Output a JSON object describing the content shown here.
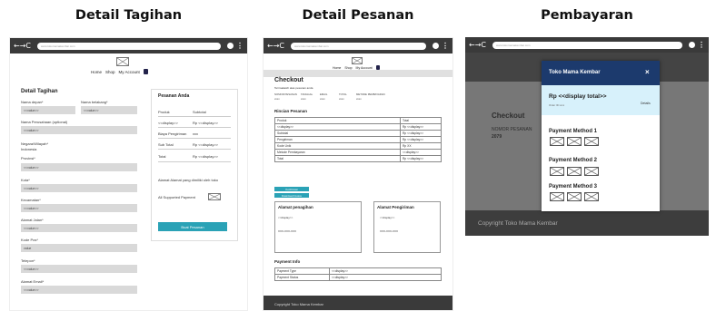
{
  "panels": {
    "tagihan": {
      "title": "Detail Tagihan"
    },
    "pesanan": {
      "title": "Detail Pesanan"
    },
    "pembayaran": {
      "title": "Pembayaran"
    }
  },
  "browser": {
    "nav": "←→C",
    "url1": "www.tokomamakembar.com",
    "url2": "www.tokomamakembar.com",
    "url3": "www.tokomamakembar.com",
    "kebab": "⋮"
  },
  "menu": {
    "home": "Home",
    "shop": "Shop",
    "account": "My Account"
  },
  "billing": {
    "heading": "Detail Tagihan",
    "first_name_label": "Nama depan*",
    "first_name_value": "<<value>>",
    "last_name_label": "Nama belakang*",
    "last_name_value": "<<value>>",
    "company_label": "Nama Perusahaan (optional)",
    "company_value": "<<value>>",
    "country_label": "Negara/Wilayah*",
    "country_value": "Indonesia",
    "province_label": "Provinsi*",
    "province_value": "<<value>>",
    "city_label": "Kota*",
    "city_value": "<<value>>",
    "district_label": "Kecamatan*",
    "district_value": "<<value>>",
    "street_label": "Alamat Jalan*",
    "street_value": "<<value>>",
    "postal_label": "Kode Pos*",
    "postal_value": "value",
    "phone_label": "Telepon*",
    "phone_value": "<<value>>",
    "email_label": "Alamat Email*",
    "email_value": "<<value>>"
  },
  "order_summary": {
    "heading": "Pesanan Anda",
    "col_product": "Produk",
    "col_subtotal": "Subtotal",
    "row_product": "<<display>>",
    "row_price": "Rp <<display>>",
    "shipping_label": "Biaya Pengiriman",
    "shipping_value": "xxx",
    "subtotal_label": "Sub Total",
    "subtotal_value": "Rp <<display>>",
    "total_label": "Total",
    "total_value": "Rp <<display>>",
    "note": "Alamat Alamat yang dimiliki oleh toko",
    "payment_label": "All Supported Payment",
    "button": "Buat Pesanan"
  },
  "checkout": {
    "title": "Checkout",
    "subtitle": "Terimakasih atas pesanan anda",
    "meta_headers": [
      "NOMOR PESANAN",
      "TANGGAL",
      "EMAIL",
      "TOTAL",
      "METODE PEMBAYARAN"
    ],
    "meta_values": [
      "xxxx",
      "xxxx",
      "xxxx",
      "xxxx",
      "xxxx"
    ],
    "rincian_heading": "Rincian Pesanan",
    "table": [
      [
        "Produk",
        "Total"
      ],
      [
        "<<display>>",
        "Rp <<display>>"
      ],
      [
        "Subtotal",
        "Rp <<display>>"
      ],
      [
        "Pengiriman",
        "Rp <<display>>"
      ],
      [
        "Kode Unik",
        "Rp XX"
      ],
      [
        "Metode Pembayaran",
        "<<display>>"
      ],
      [
        "Total",
        "Rp <<display>>"
      ]
    ],
    "btn_confirm": "Konfirmasi",
    "btn_download": "Download Invoice",
    "billing_box_title": "Alamat penagihan",
    "billing_box_line1": "<<display>>",
    "billing_box_line2": "XXX-XXX-XXX",
    "shipping_box_title": "Alamat Pengiriman",
    "shipping_box_line1": "<<display>>",
    "shipping_box_line2": "XXX-XXX-XXX",
    "payment_info_heading": "Payment Info",
    "payment_rows": [
      [
        "Payment Type",
        "<<display>>"
      ],
      [
        "Payment Status",
        "<<display>>"
      ]
    ],
    "footer": "Copyright Toko Mama Kembar"
  },
  "payment_modal": {
    "bg_title": "Checkout",
    "bg_order_label": "NOMOR PESANAN",
    "bg_order_value": "2079",
    "header": "Toko Mama Kembar",
    "close": "×",
    "total": "Rp <<display total>>",
    "order_id": "Order ID xxxx",
    "details_link": "Details",
    "methods": [
      "Payment Method 1",
      "Payment Method 2",
      "Payment Method 3"
    ],
    "footer": "Copyright Toko Mama Kembar"
  },
  "colors": {
    "teal": "#2aa2b6",
    "modal_header": "#1c3a6d",
    "total_band": "#d7f1fb",
    "browser_bar": "#3a3a3a"
  }
}
